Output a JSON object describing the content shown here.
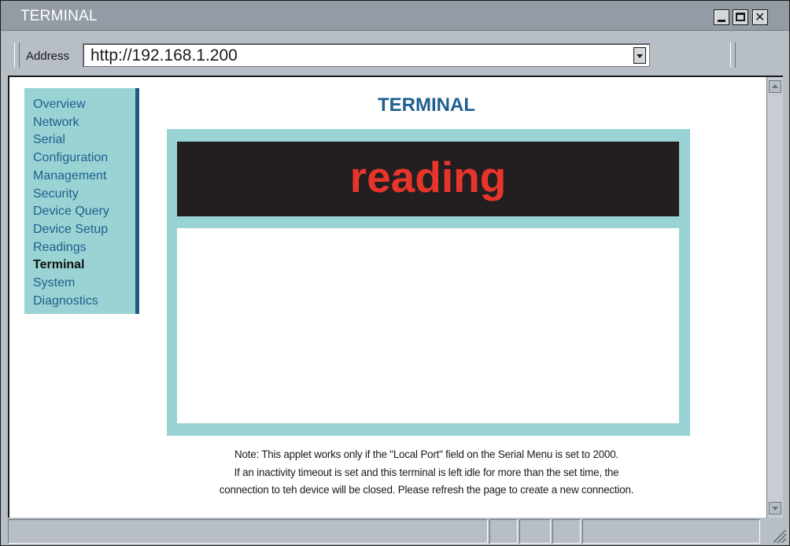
{
  "window": {
    "title": "TERMINAL"
  },
  "address_bar": {
    "label": "Address",
    "url": "http://192.168.1.200"
  },
  "sidebar": {
    "items": [
      {
        "label": "Overview",
        "active": false
      },
      {
        "label": "Network",
        "active": false
      },
      {
        "label": "Serial",
        "active": false
      },
      {
        "label": "Configuration",
        "active": false
      },
      {
        "label": "Management",
        "active": false
      },
      {
        "label": "Security",
        "active": false
      },
      {
        "label": "Device Query",
        "active": false
      },
      {
        "label": "Device Setup",
        "active": false
      },
      {
        "label": "Readings",
        "active": false
      },
      {
        "label": "Terminal",
        "active": true
      },
      {
        "label": "System",
        "active": false
      },
      {
        "label": "Diagnostics",
        "active": false
      }
    ]
  },
  "main": {
    "title": "TERMINAL",
    "terminal_status": "reading",
    "note_lines": [
      "Note: This applet works only if the \"Local Port\" field on the Serial Menu is set to 2000.",
      "If an inactivity timeout is set and this terminal is left idle for more than the set time, the",
      "connection to teh device will be closed. Please refresh the page to create a new connection."
    ]
  },
  "colors": {
    "accent": "#1e5f8e",
    "panel": "#9ad3d4",
    "status_text": "#e7352b",
    "terminal_header": "#231f20"
  },
  "icons": {
    "minimize": "minimize-icon",
    "maximize": "maximize-icon",
    "close": "close-icon",
    "dropdown": "chevron-down-icon",
    "scroll_up": "scroll-up-icon",
    "scroll_down": "scroll-down-icon",
    "resize": "resize-grip-icon"
  }
}
